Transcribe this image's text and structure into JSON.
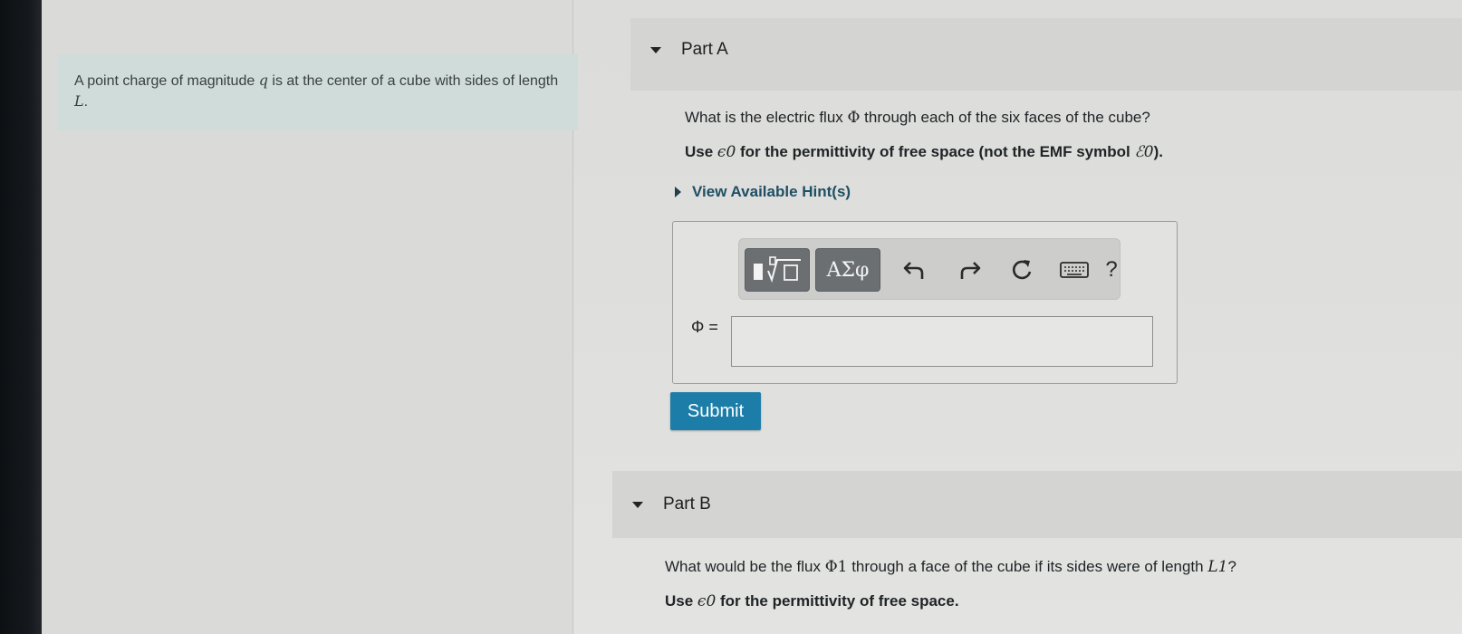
{
  "intro": {
    "text_before": "A point charge of magnitude ",
    "var_q": "q",
    "text_middle": " is at the center of a cube with sides of length ",
    "var_L": "L",
    "text_end": "."
  },
  "part_a": {
    "title": "Part A",
    "question_before": "What is the electric flux ",
    "question_symbol": "Φ",
    "question_after": " through each of the six faces of the cube?",
    "use_prefix": "Use ",
    "use_eps": "ϵ0",
    "use_middle": " for the permittivity of free space (not the EMF symbol ",
    "use_emf": "ℰ0",
    "use_suffix": ").",
    "hint_label": "View Available Hint(s)",
    "toolbar": {
      "template_icon": "templates-icon",
      "greek_label": "ΑΣφ",
      "undo_icon": "undo-icon",
      "redo_icon": "redo-icon",
      "reset_icon": "reset-icon",
      "keyboard_icon": "keyboard-icon",
      "help_label": "?"
    },
    "answer_label": "Φ =",
    "answer_value": "",
    "submit_label": "Submit"
  },
  "part_b": {
    "title": "Part B",
    "question_before": "What would be the flux ",
    "question_symbol": "Φ1",
    "question_middle": " through a face of the cube if its sides were of length ",
    "question_var": "L1",
    "question_after": "?",
    "use_prefix": "Use ",
    "use_eps": "ϵ0",
    "use_suffix": " for the permittivity of free space."
  },
  "colors": {
    "submit_bg": "#1c7ea8",
    "intro_bg": "#cfdcd9",
    "hint_link": "#1f4f64",
    "part_header_bg": "#d4d4d2"
  }
}
